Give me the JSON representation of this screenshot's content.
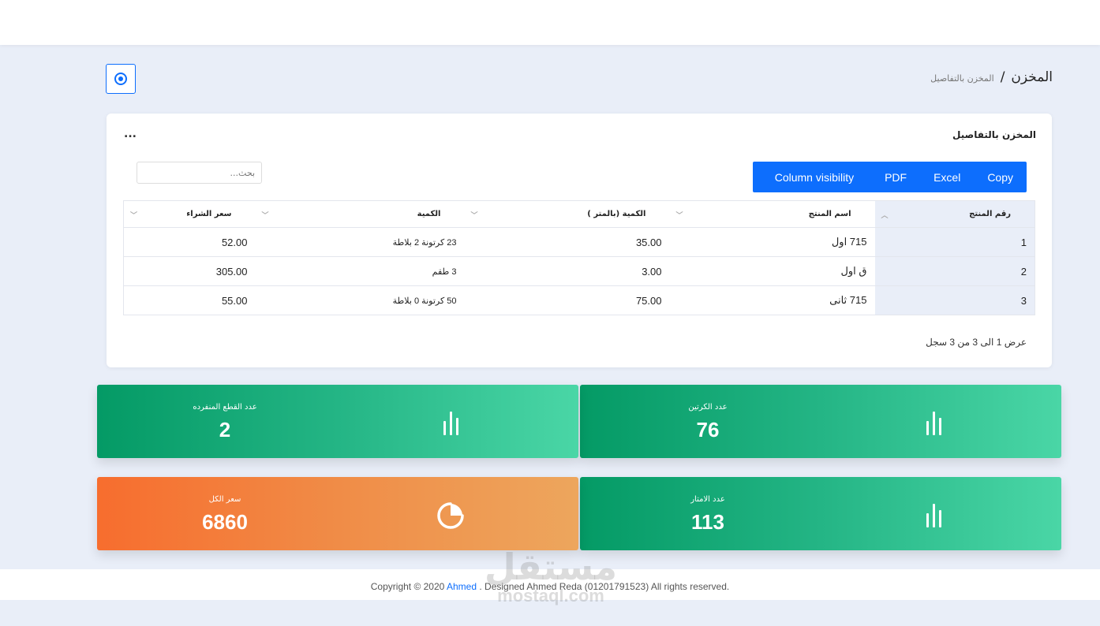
{
  "breadcrumb": {
    "main": "المخزن",
    "separator": "/",
    "sub": "المخزن بالتفاصيل"
  },
  "card": {
    "title": "المخزن بالتفاصيل",
    "menu": "...",
    "search_placeholder": "بحث...",
    "buttons": {
      "copy": "Copy",
      "excel": "Excel",
      "pdf": "PDF",
      "column_visibility": "Column visibility"
    },
    "table": {
      "headers": [
        "رقم المنتج",
        "اسم المنتج",
        "الكمية (بالمتر )",
        "الكمية",
        "سعر الشراء"
      ],
      "rows": [
        [
          "1",
          "715 اول",
          "35.00",
          "23 كرتونة 2 بلاطة",
          "52.00"
        ],
        [
          "2",
          "ق اول",
          "3.00",
          "3 طقم",
          "305.00"
        ],
        [
          "3",
          "715 ثانى",
          "75.00",
          "50 كرتونة 0 بلاطة",
          "55.00"
        ]
      ]
    },
    "info": "عرض 1 الى 3 من 3 سجل"
  },
  "stats": [
    {
      "label": "عدد الكرتين",
      "value": "76",
      "icon": "bar-chart-icon"
    },
    {
      "label": "عدد القطع المنفرده",
      "value": "2",
      "icon": "bar-chart-icon"
    },
    {
      "label": "عدد الامتار",
      "value": "113",
      "icon": "bar-chart-icon"
    },
    {
      "label": "سعر الكل",
      "value": "6860",
      "icon": "pie-chart-icon"
    }
  ],
  "footer": {
    "prefix": "Copyright © 2020 ",
    "link": "Ahmed",
    "suffix": " . Designed Ahmed Reda (01201791523) All rights reserved."
  },
  "watermark": {
    "line1": "مستقل",
    "line2": "mostaql.com"
  },
  "colors": {
    "primary": "#0d6efd",
    "green_start": "#049a65",
    "green_end": "#4ad6a6",
    "orange_start": "#f76d2e",
    "orange_end": "#eda65d"
  }
}
